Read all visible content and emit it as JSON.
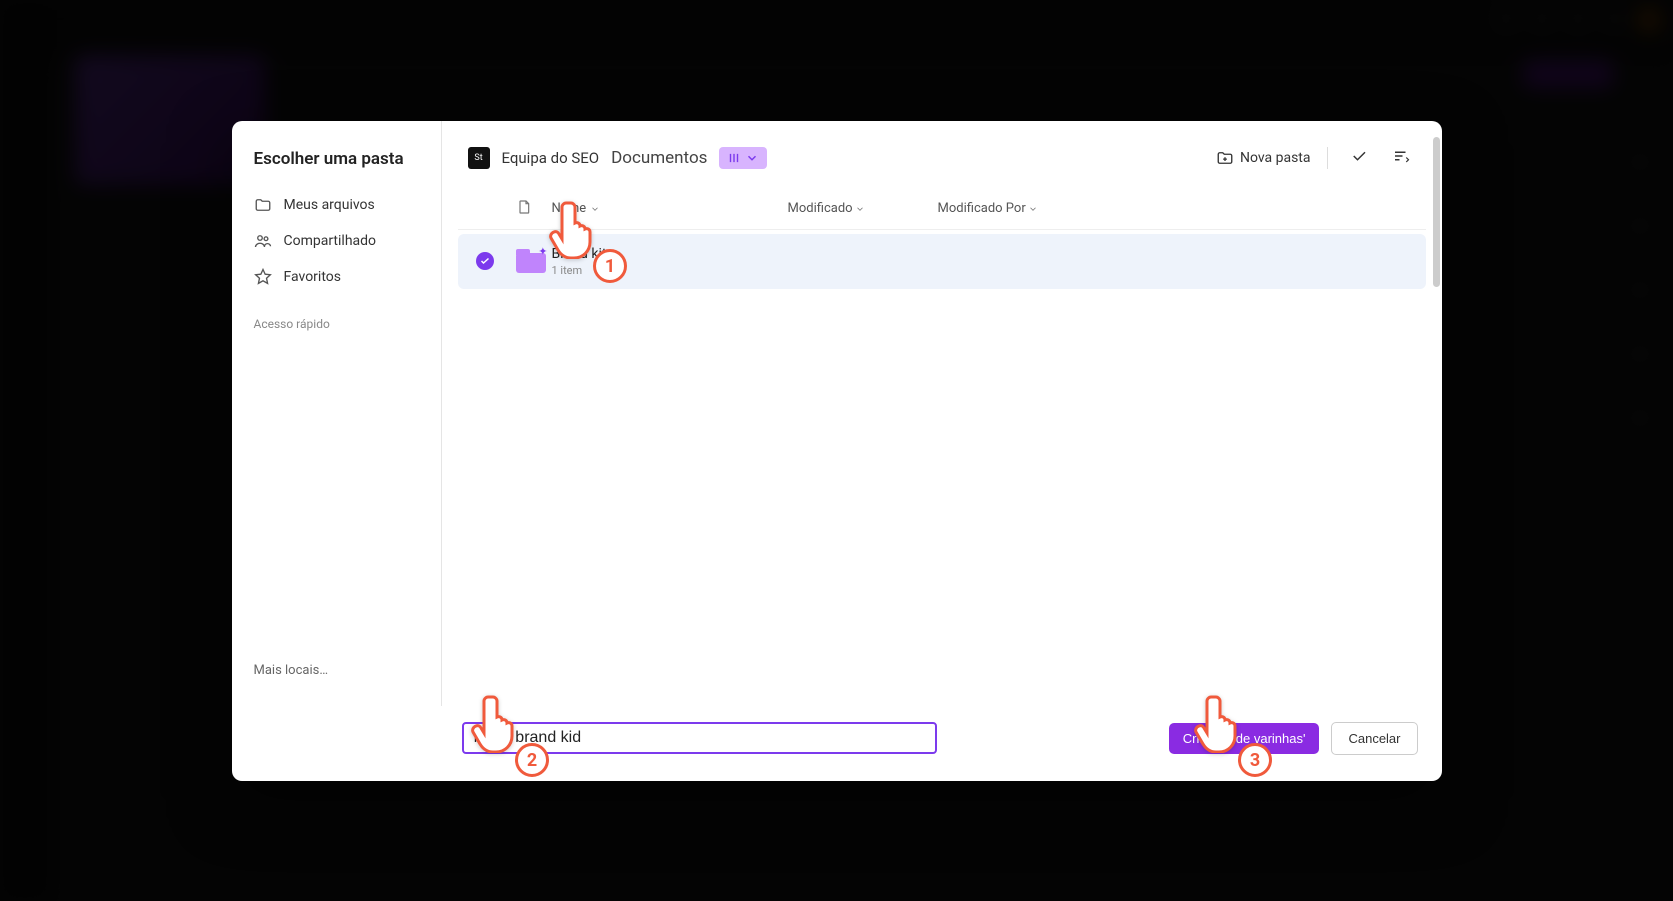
{
  "modal": {
    "title": "Escolher uma pasta",
    "sidebar": {
      "items": [
        {
          "label": "Meus arquivos"
        },
        {
          "label": "Compartilhado"
        },
        {
          "label": "Favoritos"
        }
      ],
      "quick_access_label": "Acesso rápido",
      "more_places_label": "Mais locais…"
    },
    "breadcrumb": {
      "team_badge": "St",
      "team_label": "Equipa do SEO",
      "current": "Documentos"
    },
    "toolbar": {
      "new_folder_label": "Nova pasta"
    },
    "columns": {
      "name": "Name",
      "modified": "Modificado",
      "modified_by": "Modificado Por"
    },
    "rows": [
      {
        "name": "Brand kit",
        "sub": "1 item"
      }
    ],
    "footer": {
      "input_value": "Novo brand kid",
      "create_label": "Criar 'Kit de varinhas'",
      "cancel_label": "Cancelar"
    }
  },
  "annotations": {
    "p1": "1",
    "p2": "2",
    "p3": "3"
  }
}
